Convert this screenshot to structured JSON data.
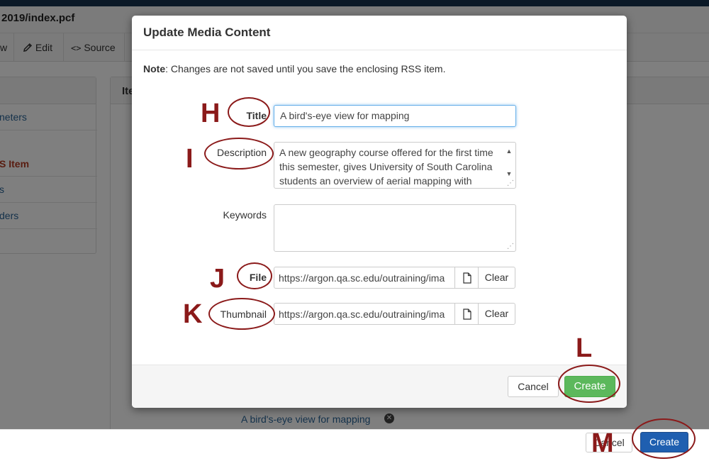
{
  "background": {
    "path": "2019/index.pcf",
    "toolbar": {
      "view": "w",
      "edit": "Edit",
      "source": "Source"
    },
    "main_panel_title": "Ite",
    "sidebar": [
      {
        "label": "neters"
      },
      {
        "label": "S Item"
      },
      {
        "label": "s"
      },
      {
        "label": "ders"
      }
    ],
    "media_item": "A bird's-eye view for mapping",
    "footer": {
      "cancel": "Cancel",
      "create": "Create"
    }
  },
  "modal": {
    "title": "Update Media Content",
    "note_label": "Note",
    "note_text": ": Changes are not saved until you save the enclosing RSS item.",
    "fields": {
      "title": {
        "label": "Title",
        "value": "A bird's-eye view for mapping"
      },
      "description": {
        "label": "Description",
        "value": "A new geography course offered for the first time this semester, gives University of South Carolina students an overview of aerial mapping with"
      },
      "keywords": {
        "label": "Keywords",
        "value": ""
      },
      "file": {
        "label": "File",
        "value": "https://argon.qa.sc.edu/outraining/ima",
        "clear": "Clear"
      },
      "thumbnail": {
        "label": "Thumbnail",
        "value": "https://argon.qa.sc.edu/outraining/ima",
        "clear": "Clear"
      }
    },
    "cancel": "Cancel",
    "create": "Create"
  },
  "annotations": {
    "h": "H",
    "i": "I",
    "j": "J",
    "k": "K",
    "l": "L",
    "m": "M"
  },
  "colors": {
    "annotation": "#8b1a1a",
    "create_green": "#5cb85c",
    "create_blue": "#1f5fb0"
  }
}
